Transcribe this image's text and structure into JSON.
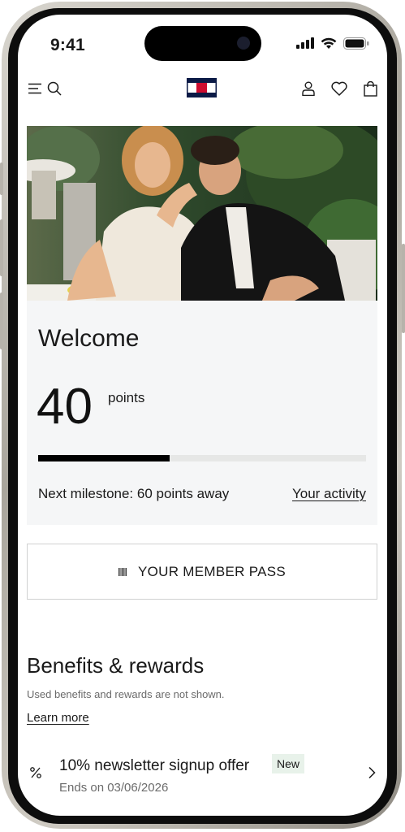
{
  "status_bar": {
    "time": "9:41"
  },
  "header": {
    "menu_icon": "hamburger-icon",
    "search_icon": "search-icon",
    "logo": "tommy-flag-logo",
    "account_icon": "user-icon",
    "wishlist_icon": "heart-icon",
    "bag_icon": "shopping-bag-icon"
  },
  "welcome": {
    "title": "Welcome",
    "points": "40",
    "points_unit": "points",
    "progress_fraction": 0.4,
    "milestone_text": "Next milestone: 60 points away",
    "activity_link": "Your activity"
  },
  "member_pass": {
    "label": "YOUR MEMBER PASS",
    "icon": "barcode-icon"
  },
  "benefits": {
    "title": "Benefits & rewards",
    "note": "Used benefits and rewards are not shown.",
    "learn_more": "Learn more",
    "offers": [
      {
        "icon": "percent-icon",
        "title": "10% newsletter signup offer",
        "badge": "New",
        "subtitle": "Ends on 03/06/2026"
      }
    ]
  },
  "colors": {
    "brand_navy": "#0b1a46",
    "brand_red": "#cc0c2f",
    "card_bg": "#f5f6f7",
    "badge_bg": "#e8f2ea"
  }
}
